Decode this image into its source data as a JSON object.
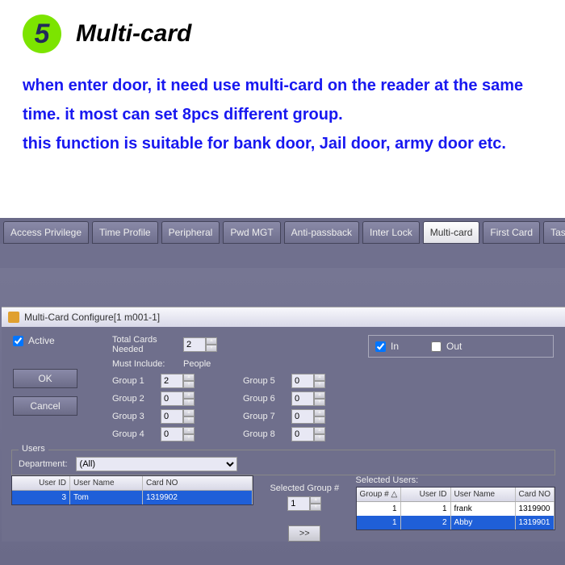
{
  "header": {
    "badge_number": "5",
    "title": "Multi-card"
  },
  "description": "when enter door, it need use multi-card on the reader at the same time.  it most can set 8pcs different group.\nthis function is suitable for bank door, Jail door, army door etc.",
  "tabs": [
    "Access Privilege",
    "Time Profile",
    "Peripheral",
    "Pwd MGT",
    "Anti-passback",
    "Inter Lock",
    "Multi-card",
    "First Card",
    "Task List"
  ],
  "tabs_active_index": 6,
  "dialog": {
    "title": "Multi-Card Configure[1   m001-1]",
    "active_label": "Active",
    "ok_label": "OK",
    "cancel_label": "Cancel",
    "total_cards_label": "Total Cards Needed",
    "total_cards_value": "2",
    "must_include_label": "Must Include:",
    "must_include_right": "People",
    "groups_left": [
      {
        "label": "Group 1",
        "value": "2"
      },
      {
        "label": "Group 2",
        "value": "0"
      },
      {
        "label": "Group 3",
        "value": "0"
      },
      {
        "label": "Group 4",
        "value": "0"
      }
    ],
    "groups_right": [
      {
        "label": "Group 5",
        "value": "0"
      },
      {
        "label": "Group 6",
        "value": "0"
      },
      {
        "label": "Group 7",
        "value": "0"
      },
      {
        "label": "Group 8",
        "value": "0"
      }
    ],
    "in_label": "In",
    "out_label": "Out"
  },
  "users": {
    "legend": "Users",
    "department_label": "Department:",
    "department_value": "(All)",
    "table_headers": [
      "User ID",
      "User Name",
      "Card NO"
    ],
    "rows": [
      {
        "id": "3",
        "name": "Tom",
        "card": "1319902"
      }
    ]
  },
  "mid": {
    "selected_group_label": "Selected Group #",
    "selected_group_value": "1",
    "move_button": ">>"
  },
  "selected_users": {
    "legend": "Selected Users:",
    "headers": [
      "Group #",
      "User ID",
      "User Name",
      "Card NO"
    ],
    "delta": "△",
    "rows": [
      {
        "group": "1",
        "id": "1",
        "name": "frank",
        "card": "1319900"
      },
      {
        "group": "1",
        "id": "2",
        "name": "Abby",
        "card": "1319901"
      }
    ]
  }
}
